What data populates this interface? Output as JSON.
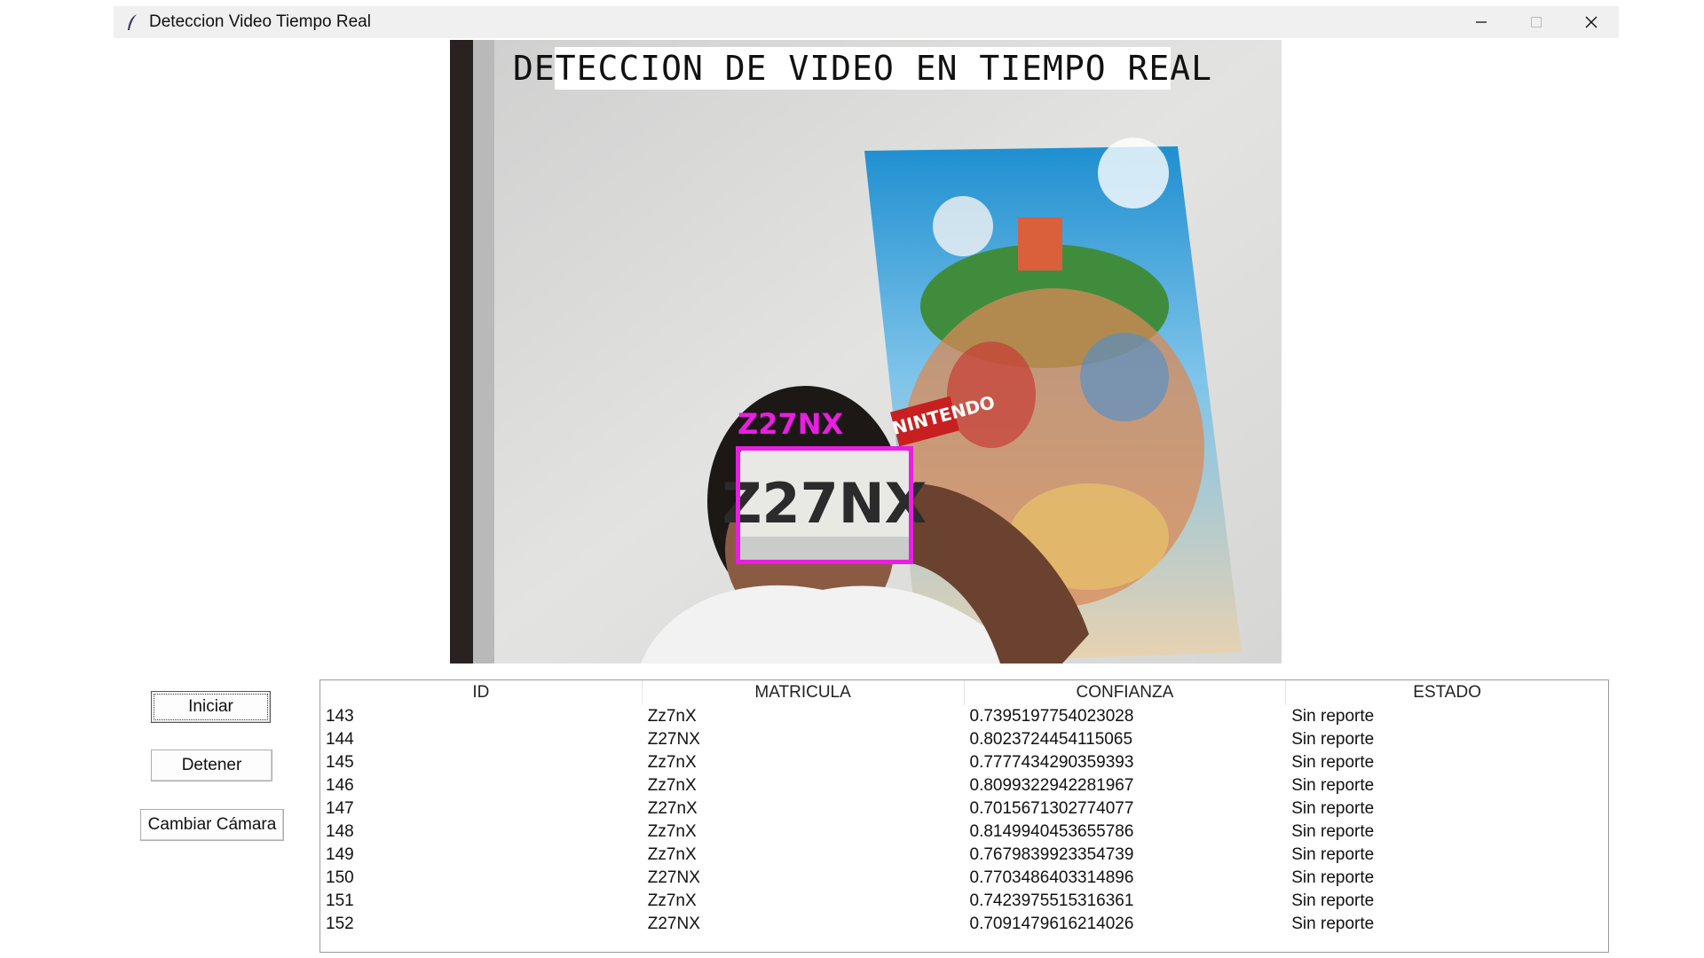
{
  "window": {
    "title": "Deteccion Video Tiempo Real"
  },
  "video": {
    "overlay_title": "DETECCION DE VIDEO EN TIEMPO REAL",
    "detection_label": "Z27NX",
    "plate_text": "Z27NX",
    "poster_text": "NINTENDO",
    "box_color": "#e81fe0"
  },
  "controls": {
    "start_label": "Iniciar",
    "stop_label": "Detener",
    "switch_camera_label": "Cambiar Cámara"
  },
  "table": {
    "columns": [
      "ID",
      "MATRICULA",
      "CONFIANZA",
      "ESTADO"
    ],
    "rows": [
      [
        "143",
        "Zz7nX",
        "0.7395197754023028",
        "Sin reporte"
      ],
      [
        "144",
        "Z27NX",
        "0.8023724454115065",
        "Sin reporte"
      ],
      [
        "145",
        "Zz7nX",
        "0.7777434290359393",
        "Sin reporte"
      ],
      [
        "146",
        "Zz7nX",
        "0.8099322942281967",
        "Sin reporte"
      ],
      [
        "147",
        "Z27nX",
        "0.7015671302774077",
        "Sin reporte"
      ],
      [
        "148",
        "Zz7nX",
        "0.8149940453655786",
        "Sin reporte"
      ],
      [
        "149",
        "Zz7nX",
        "0.7679839923354739",
        "Sin reporte"
      ],
      [
        "150",
        "Z27NX",
        "0.7703486403314896",
        "Sin reporte"
      ],
      [
        "151",
        "Zz7nX",
        "0.7423975515316361",
        "Sin reporte"
      ],
      [
        "152",
        "Z27NX",
        "0.7091479616214026",
        "Sin reporte"
      ]
    ]
  }
}
